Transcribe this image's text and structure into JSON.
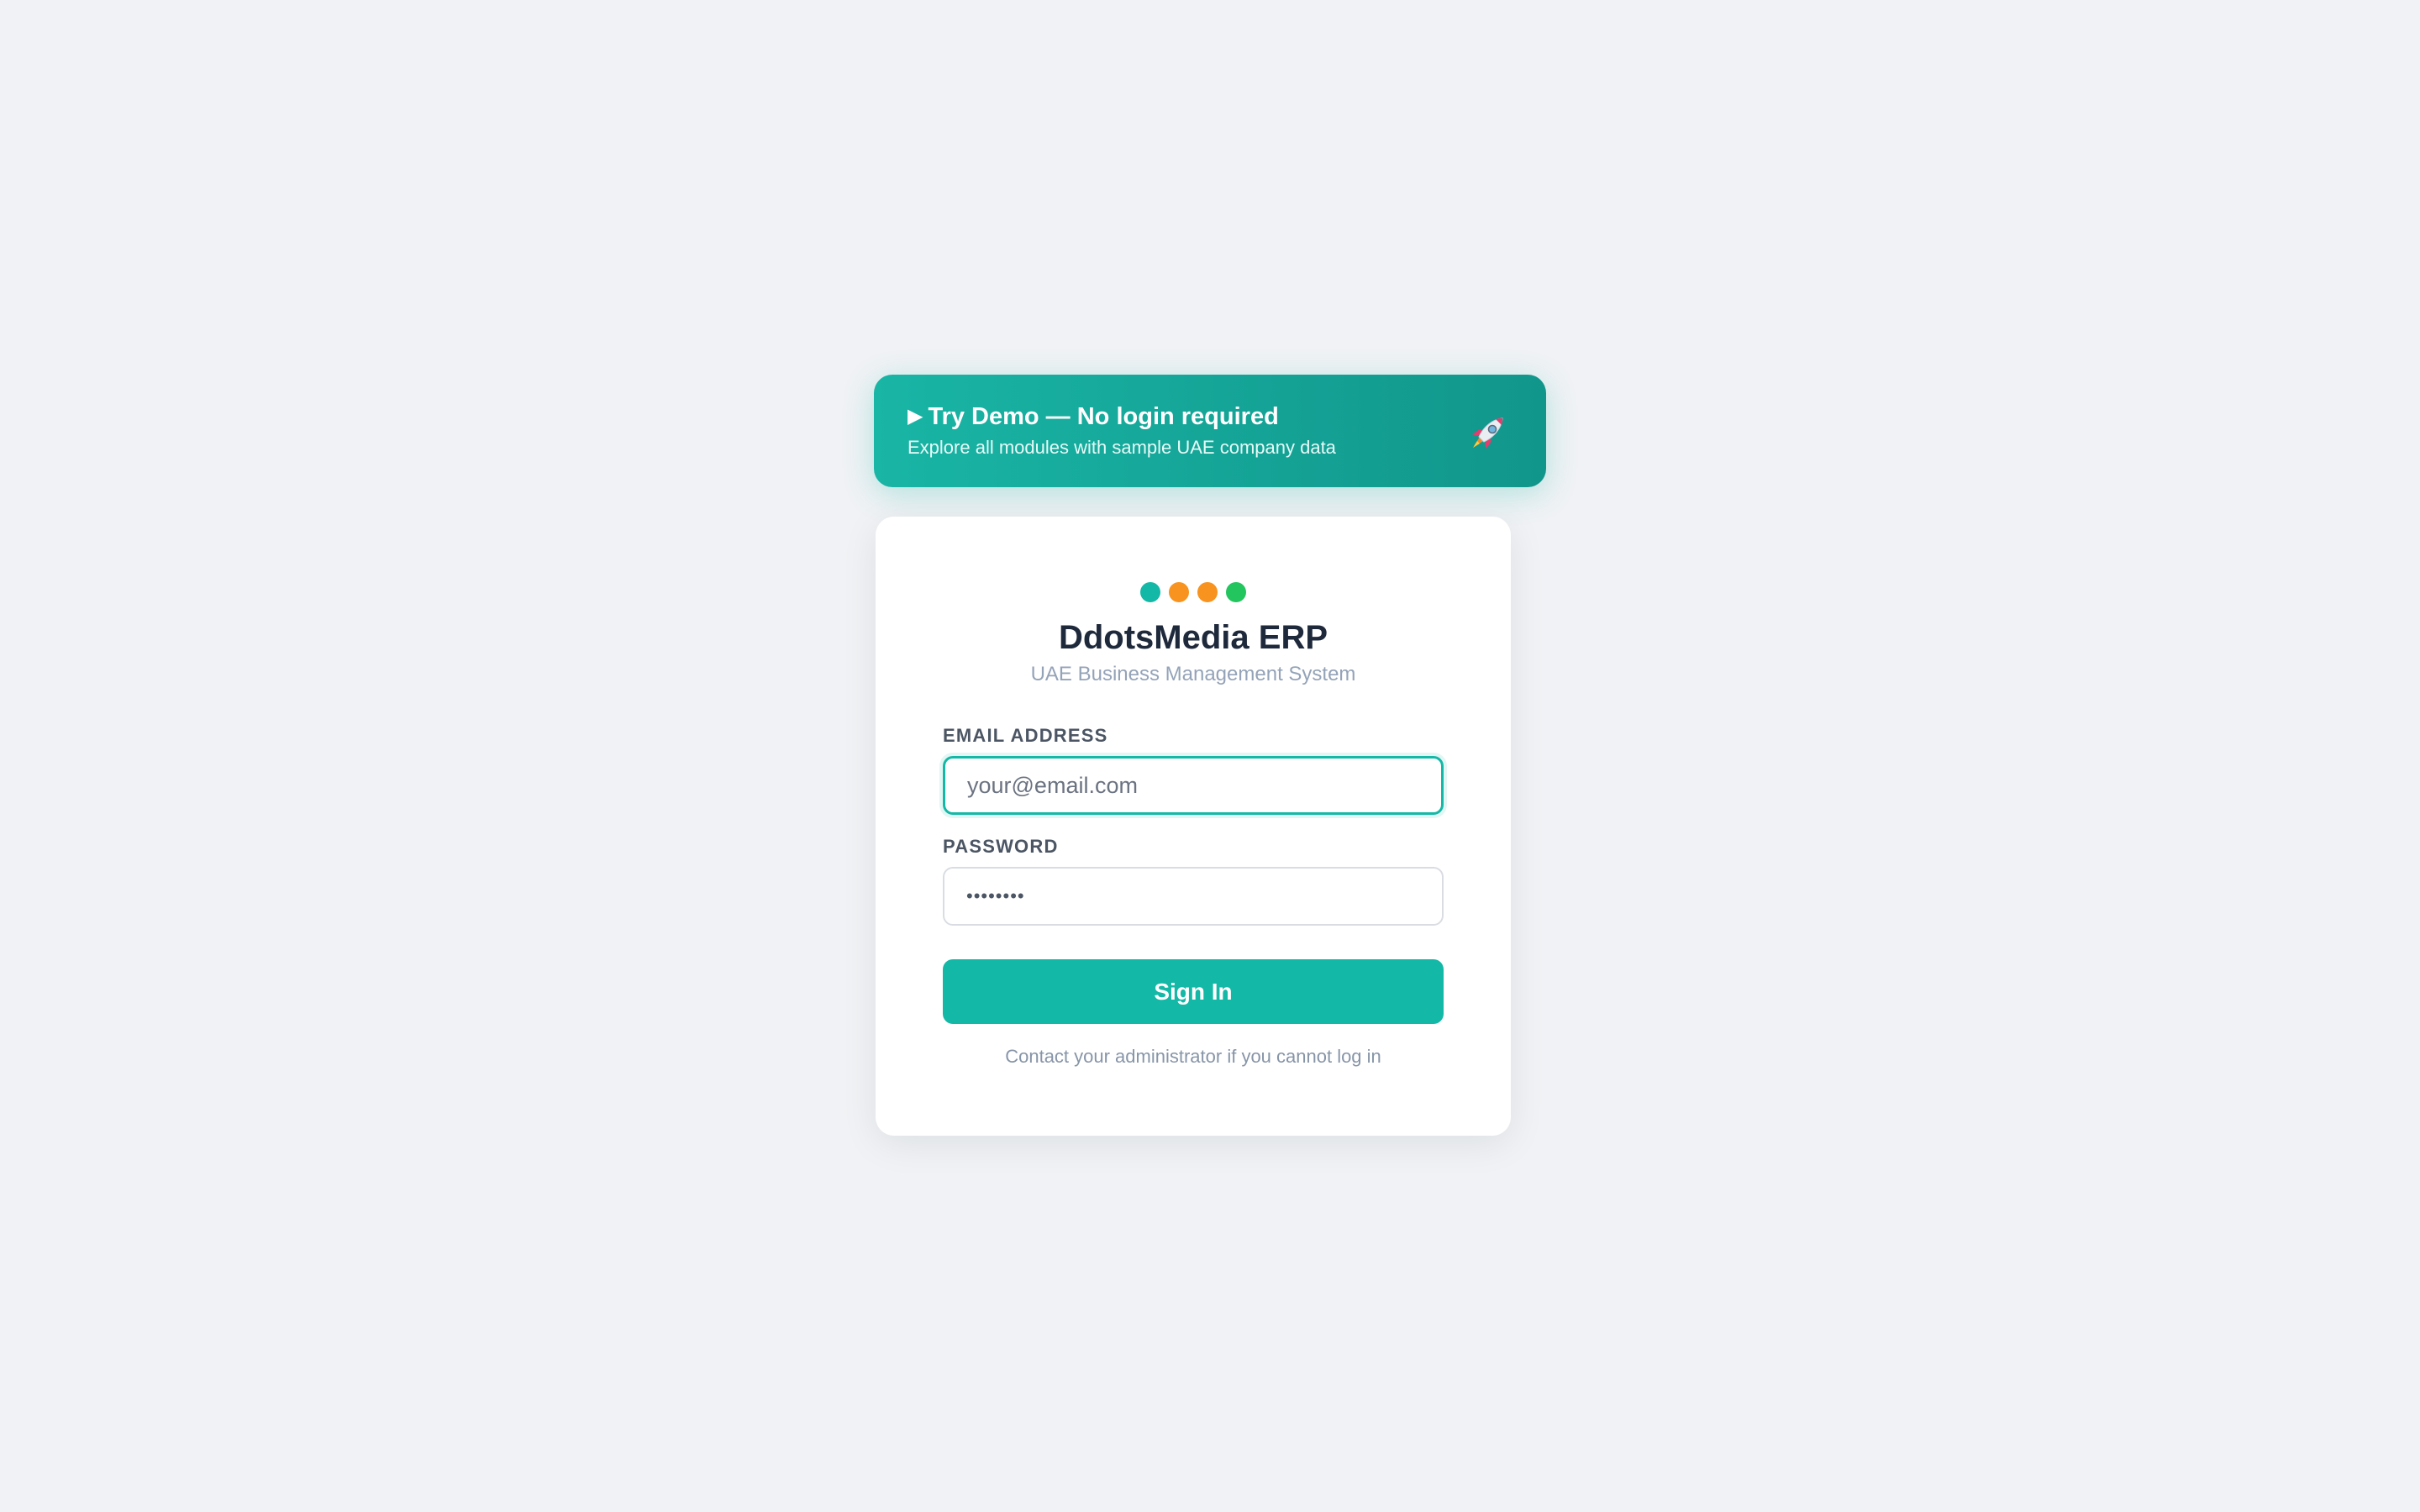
{
  "demo": {
    "play_icon": "▶",
    "title": "Try Demo — No login required",
    "subtitle": "Explore all modules with sample UAE company data",
    "icon": "rocket-icon"
  },
  "brand": {
    "dots": [
      "#14b8a6",
      "#f7931e",
      "#f7931e",
      "#22c55e"
    ],
    "title": "DdotsMedia ERP",
    "subtitle": "UAE Business Management System"
  },
  "form": {
    "email_label": "EMAIL ADDRESS",
    "email_placeholder": "your@email.com",
    "email_value": "",
    "password_label": "PASSWORD",
    "password_value": "••••••••",
    "submit_label": "Sign In",
    "help_text": "Contact your administrator if you cannot log in"
  },
  "colors": {
    "accent": "#14b8a6",
    "accent_dark": "#11968b",
    "background": "#f0f2f5",
    "card": "#ffffff",
    "title_text": "#1e293b",
    "muted_text": "#94a3b8"
  }
}
